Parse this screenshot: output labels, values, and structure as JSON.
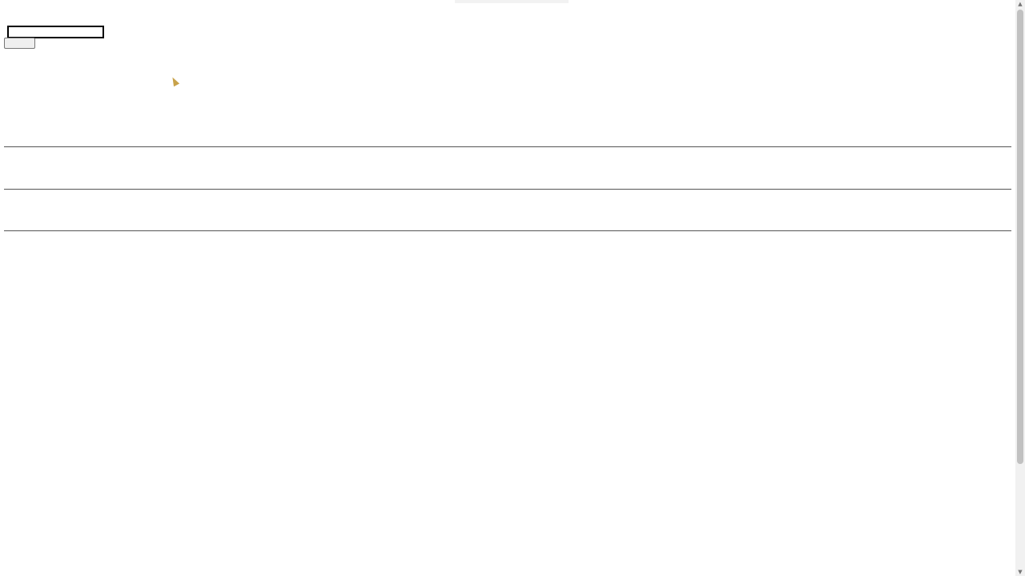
{
  "colors": {
    "page_background": "#ffffff",
    "text": "#222222",
    "rule": "#555555",
    "input_border": "#000000",
    "scrollbar_track": "#f1f1f1",
    "scrollbar_thumb": "#c1c1c1",
    "cursor": "#c8a24a"
  },
  "icons": {
    "scroll_up": "scroll-up-arrow-icon",
    "scroll_down": "scroll-down-arrow-icon",
    "cursor": "mouse-pointer-icon"
  },
  "header": {
    "status_text": ""
  },
  "form": {
    "character_label": "",
    "character_value": "",
    "search_label": ""
  },
  "names_section": {
    "heading": "",
    "lines": [
      "",
      "",
      "",
      "",
      "",
      "",
      "",
      ""
    ]
  },
  "raw_section": {
    "heading": "",
    "value": ""
  },
  "entities_section": {
    "heading": "",
    "value": ""
  },
  "detail_section": {
    "heading": "",
    "characters": [
      {
        "summary": "",
        "lines": [
          ""
        ]
      },
      {
        "summary": "",
        "lines": [
          ""
        ]
      },
      {
        "summary": "",
        "lines": [
          "",
          ""
        ]
      },
      {
        "summary": "",
        "lines": [
          "",
          "",
          ""
        ]
      },
      {
        "summary": "",
        "lines": [
          "",
          "",
          "",
          "",
          "",
          "",
          "",
          ""
        ]
      },
      {
        "summary": "",
        "lines": [
          "",
          "",
          ""
        ]
      }
    ]
  }
}
